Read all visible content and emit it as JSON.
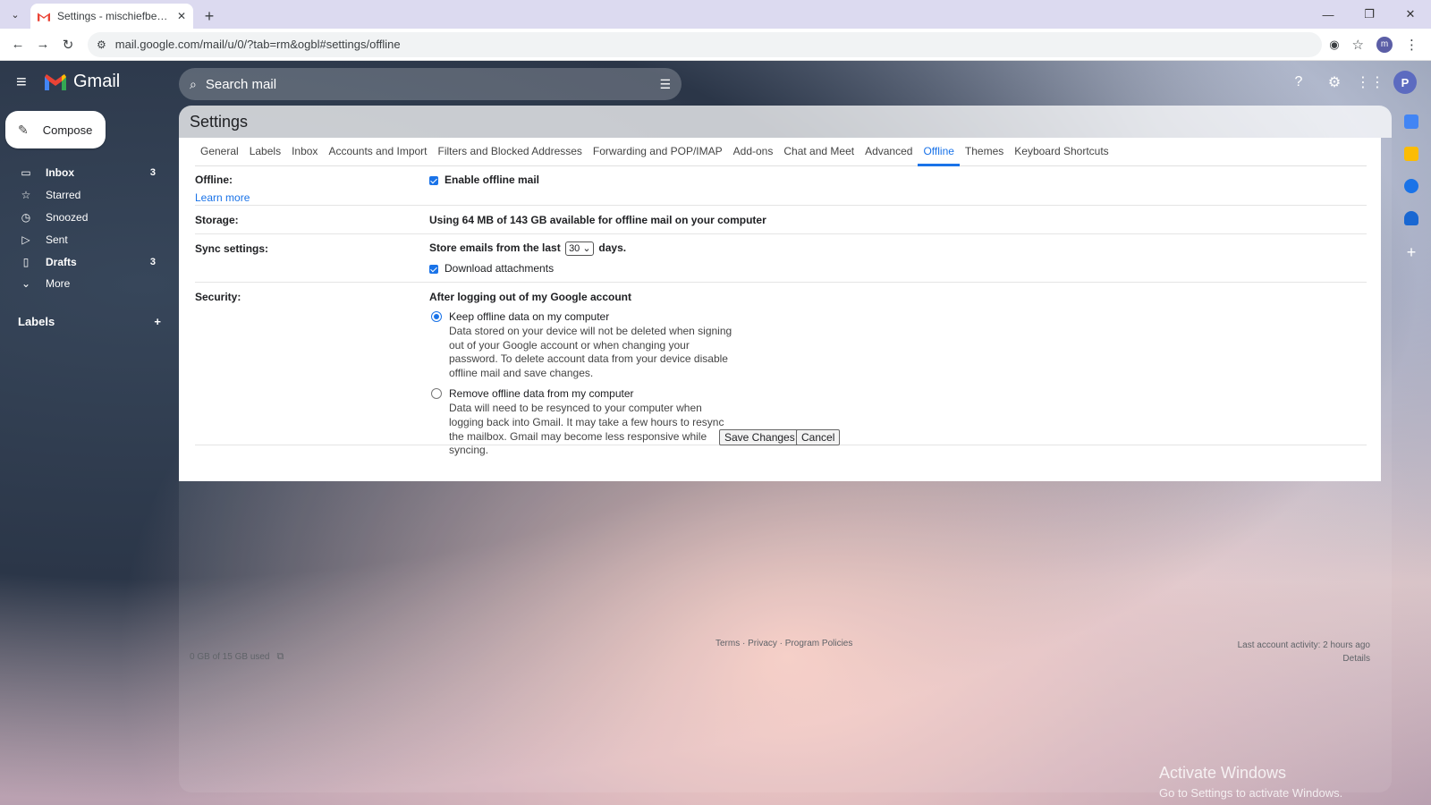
{
  "browser": {
    "tab_title": "Settings - mischiefbedlam@gm",
    "url": "mail.google.com/mail/u/0/?tab=rm&ogbl#settings/offline",
    "profile_initial": "m"
  },
  "gmail": {
    "logo_text": "Gmail",
    "search_placeholder": "Search mail",
    "avatar_initial": "P",
    "compose_label": "Compose",
    "nav": [
      {
        "label": "Inbox",
        "count": "3",
        "icon": "inbox-icon"
      },
      {
        "label": "Starred",
        "count": "",
        "icon": "star-icon"
      },
      {
        "label": "Snoozed",
        "count": "",
        "icon": "clock-icon"
      },
      {
        "label": "Sent",
        "count": "",
        "icon": "send-icon"
      },
      {
        "label": "Drafts",
        "count": "3",
        "icon": "file-icon"
      },
      {
        "label": "More",
        "count": "",
        "icon": "chevron-down-icon"
      }
    ],
    "labels_header": "Labels"
  },
  "settings": {
    "title": "Settings",
    "tabs": [
      "General",
      "Labels",
      "Inbox",
      "Accounts and Import",
      "Filters and Blocked Addresses",
      "Forwarding and POP/IMAP",
      "Add-ons",
      "Chat and Meet",
      "Advanced",
      "Offline",
      "Themes",
      "Keyboard Shortcuts"
    ],
    "active_tab": "Offline",
    "offline_label": "Offline:",
    "learn_more": "Learn more",
    "enable_offline": "Enable offline mail",
    "storage_label": "Storage:",
    "storage_text": "Using 64 MB of 143 GB available for offline mail on your computer",
    "sync_label": "Sync settings:",
    "sync_prefix": "Store emails from the last",
    "sync_days": "30",
    "sync_suffix": "days.",
    "download_attachments": "Download attachments",
    "security_label": "Security:",
    "security_heading": "After logging out of my Google account",
    "keep_title": "Keep offline data on my computer",
    "keep_desc": "Data stored on your device will not be deleted when signing out of your Google account or when changing your password. To delete account data from your device disable offline mail and save changes.",
    "remove_title": "Remove offline data from my computer",
    "remove_desc": "Data will need to be resynced to your computer when logging back into Gmail. It may take a few hours to resync the mailbox. Gmail may become less responsive while syncing.",
    "save_label": "Save Changes",
    "cancel_label": "Cancel"
  },
  "footer": {
    "storage_used": "0 GB of 15 GB used",
    "links": "Terms · Privacy · Program Policies",
    "last_activity": "Last account activity: 2 hours ago",
    "details": "Details"
  },
  "watermark": {
    "title": "Activate Windows",
    "subtitle": "Go to Settings to activate Windows."
  },
  "colors": {
    "accent": "#1a73e8"
  }
}
